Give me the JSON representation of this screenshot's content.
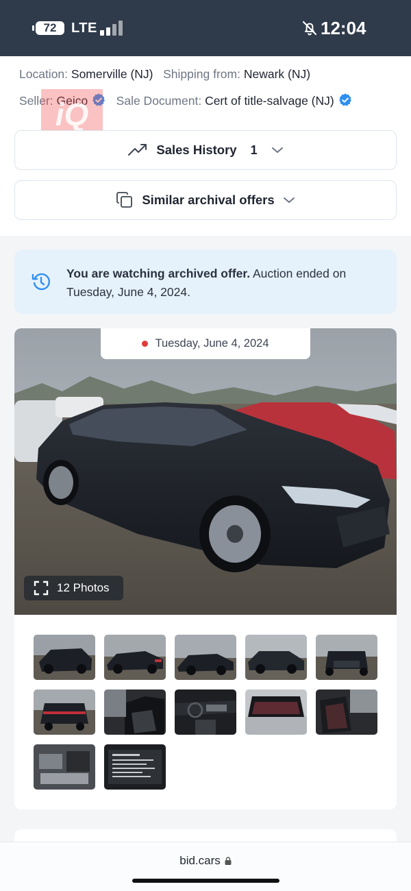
{
  "status_bar": {
    "battery": "72",
    "network": "LTE",
    "time": "12:04",
    "icons": [
      "signal-icon",
      "bell-muted-icon"
    ]
  },
  "lot_info": {
    "location_label": "Location:",
    "location_value": "Somerville (NJ)",
    "shipping_label": "Shipping from:",
    "shipping_value": "Newark (NJ)",
    "seller_label": "Seller:",
    "seller_value": "Geico",
    "document_label": "Sale Document:",
    "document_value": "Cert of title-salvage (NJ)",
    "watermark": "iQ"
  },
  "sales_history": {
    "label": "Sales History",
    "count": "1",
    "icon": "trending-up-icon"
  },
  "similar_offers": {
    "label": "Similar archival offers",
    "icon": "copy-icon"
  },
  "archived_notice": {
    "bold_text": "You are watching archived offer.",
    "text": " Auction ended on Tuesday, June 4, 2024.",
    "icon": "history-icon"
  },
  "gallery": {
    "date": "Tuesday, June 4, 2024",
    "photos_label": "12 Photos",
    "thumbnails": [
      "front-left damaged",
      "left side",
      "left rear",
      "right side",
      "front",
      "rear",
      "driver interior",
      "dashboard",
      "trunk",
      "rear seats",
      "engine bay",
      "label sticker"
    ]
  },
  "browser": {
    "url": "bid.cars"
  },
  "colors": {
    "header_bg": "#2f3a4a",
    "notice_bg": "#e6f2fb",
    "verified_blue": "#2f8ff0",
    "date_dot": "#e03b3b"
  }
}
